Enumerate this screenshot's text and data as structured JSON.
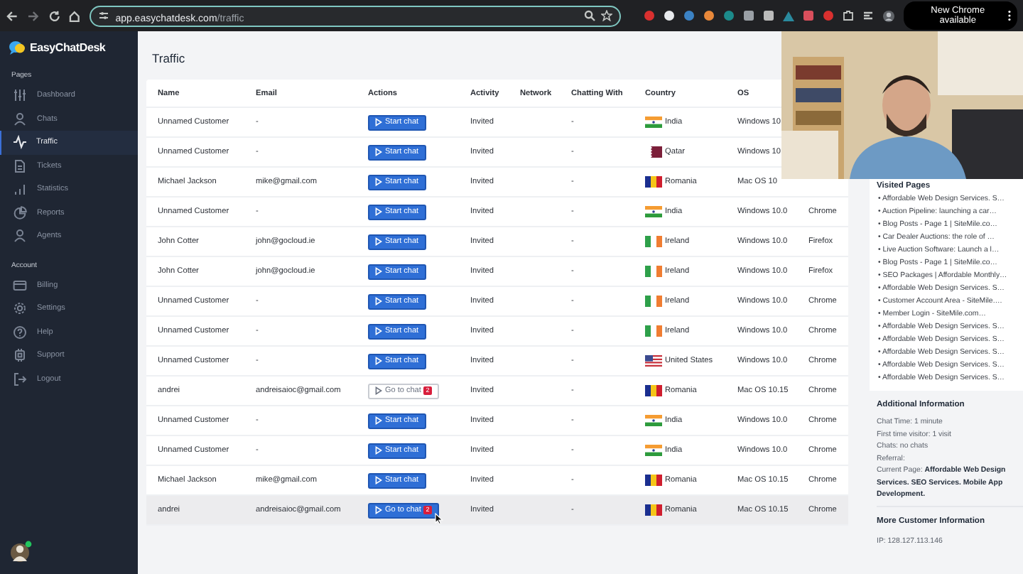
{
  "browser": {
    "url_host": "app.easychatdesk.com",
    "url_path": "/traffic",
    "update_button": "New Chrome available"
  },
  "sidebar": {
    "logo": "EasyChatDesk",
    "sections": [
      {
        "title": "Pages",
        "items": [
          {
            "label": "Dashboard",
            "selected": false
          },
          {
            "label": "Chats",
            "selected": false
          },
          {
            "label": "Traffic",
            "selected": true
          },
          {
            "label": "Tickets",
            "selected": false
          },
          {
            "label": "Statistics",
            "selected": false
          },
          {
            "label": "Reports",
            "selected": false
          },
          {
            "label": "Agents",
            "selected": false
          }
        ]
      },
      {
        "title": "Account",
        "items": [
          {
            "label": "Billing",
            "selected": false
          },
          {
            "label": "Settings",
            "selected": false
          },
          {
            "label": "Help",
            "selected": false
          },
          {
            "label": "Support",
            "selected": false
          },
          {
            "label": "Logout",
            "selected": false
          }
        ]
      }
    ]
  },
  "page": {
    "title": "Traffic"
  },
  "table": {
    "columns": [
      "Name",
      "Email",
      "Actions",
      "Activity",
      "Network",
      "Chatting With",
      "Country",
      "OS"
    ],
    "rows": [
      {
        "name": "Unnamed Customer",
        "email": "-",
        "action": {
          "kind": "start",
          "label": "Start chat"
        },
        "activity": "Invited",
        "chatting_with": "-",
        "country": "India",
        "os": "Windows 10",
        "hovered": false
      },
      {
        "name": "Unnamed Customer",
        "email": "-",
        "action": {
          "kind": "start",
          "label": "Start chat"
        },
        "activity": "Invited",
        "chatting_with": "-",
        "country": "Qatar",
        "os": "Windows 10",
        "hovered": false
      },
      {
        "name": "Michael Jackson",
        "email": "mike@gmail.com",
        "action": {
          "kind": "start",
          "label": "Start chat"
        },
        "activity": "Invited",
        "chatting_with": "-",
        "country": "Romania",
        "os": "Mac OS 10",
        "hovered": false
      },
      {
        "name": "Unnamed Customer",
        "email": "-",
        "action": {
          "kind": "start",
          "label": "Start chat"
        },
        "activity": "Invited",
        "chatting_with": "-",
        "country": "India",
        "os": "Windows 10.0",
        "browser": "Chrome",
        "hovered": false
      },
      {
        "name": "John Cotter",
        "email": "john@gocloud.ie",
        "action": {
          "kind": "start",
          "label": "Start chat"
        },
        "activity": "Invited",
        "chatting_with": "-",
        "country": "Ireland",
        "os": "Windows 10.0",
        "browser": "Firefox",
        "hovered": false
      },
      {
        "name": "John Cotter",
        "email": "john@gocloud.ie",
        "action": {
          "kind": "start",
          "label": "Start chat"
        },
        "activity": "Invited",
        "chatting_with": "-",
        "country": "Ireland",
        "os": "Windows 10.0",
        "browser": "Firefox",
        "hovered": false
      },
      {
        "name": "Unnamed Customer",
        "email": "-",
        "action": {
          "kind": "start",
          "label": "Start chat"
        },
        "activity": "Invited",
        "chatting_with": "-",
        "country": "Ireland",
        "os": "Windows 10.0",
        "browser": "Chrome",
        "hovered": false
      },
      {
        "name": "Unnamed Customer",
        "email": "-",
        "action": {
          "kind": "start",
          "label": "Start chat"
        },
        "activity": "Invited",
        "chatting_with": "-",
        "country": "Ireland",
        "os": "Windows 10.0",
        "browser": "Chrome",
        "hovered": false
      },
      {
        "name": "Unnamed Customer",
        "email": "-",
        "action": {
          "kind": "start",
          "label": "Start chat"
        },
        "activity": "Invited",
        "chatting_with": "-",
        "country": "United States",
        "os": "Windows 10.0",
        "browser": "Chrome",
        "hovered": false
      },
      {
        "name": "andrei",
        "email": "andreisaioc@gmail.com",
        "action": {
          "kind": "goto",
          "label": "Go to chat",
          "badge": "2"
        },
        "activity": "Invited",
        "chatting_with": "-",
        "country": "Romania",
        "os": "Mac OS 10.15",
        "browser": "Chrome",
        "hovered": false
      },
      {
        "name": "Unnamed Customer",
        "email": "-",
        "action": {
          "kind": "start",
          "label": "Start chat"
        },
        "activity": "Invited",
        "chatting_with": "-",
        "country": "India",
        "os": "Windows 10.0",
        "browser": "Chrome",
        "hovered": false
      },
      {
        "name": "Unnamed Customer",
        "email": "-",
        "action": {
          "kind": "start",
          "label": "Start chat"
        },
        "activity": "Invited",
        "chatting_with": "-",
        "country": "India",
        "os": "Windows 10.0",
        "browser": "Chrome",
        "hovered": false
      },
      {
        "name": "Michael Jackson",
        "email": "mike@gmail.com",
        "action": {
          "kind": "start",
          "label": "Start chat"
        },
        "activity": "Invited",
        "chatting_with": "-",
        "country": "Romania",
        "os": "Mac OS 10.15",
        "browser": "Chrome",
        "hovered": false
      },
      {
        "name": "andrei",
        "email": "andreisaioc@gmail.com",
        "action": {
          "kind": "goto",
          "label": "Go to chat",
          "badge": "2"
        },
        "activity": "Invited",
        "chatting_with": "-",
        "country": "Romania",
        "os": "Mac OS 10.15",
        "browser": "Chrome",
        "hovered": true
      }
    ]
  },
  "visited_pages": {
    "title": "Visited Pages",
    "items": [
      "• Affordable Web Design Services. S…",
      "• Auction Pipeline: launching a car…",
      "• Blog Posts - Page 1 | SiteMile.co…",
      "• Car Dealer Auctions: the role of …",
      "• Live Auction Software: Launch a l…",
      "• Blog Posts - Page 1 | SiteMile.co…",
      "• SEO Packages | Affordable Monthly…",
      "• Affordable Web Design Services. S…",
      "• Customer Account Area - SiteMile.…",
      "• Member Login - SiteMile.com…",
      "• Affordable Web Design Services. S…",
      "• Affordable Web Design Services. S…",
      "• Affordable Web Design Services. S…",
      "• Affordable Web Design Services. S…",
      "• Affordable Web Design Services. S…"
    ]
  },
  "additional_info": {
    "title": "Additional Information",
    "lines": [
      "Chat Time: 1 minute",
      "First time visitor: 1 visit",
      "Chats: no chats",
      "Referral:",
      "Current Page: **Affordable Web Design Services. SEO Services. Mobile App Development.**"
    ]
  },
  "more_info": {
    "title": "More Customer Information",
    "lines": [
      "IP: 128.127.113.146"
    ]
  }
}
